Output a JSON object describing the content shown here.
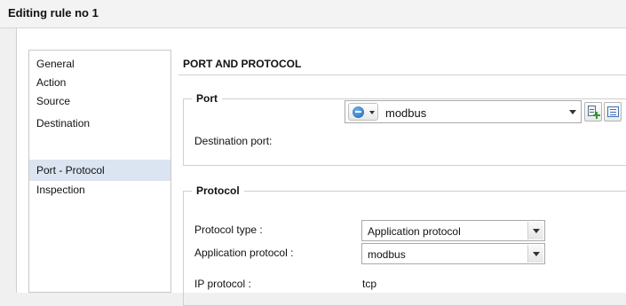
{
  "window": {
    "title": "Editing rule no 1"
  },
  "nav": {
    "items": [
      {
        "label": "General"
      },
      {
        "label": "Action"
      },
      {
        "label": "Source"
      },
      {
        "label": "Destination"
      },
      {
        "label": "Port - Protocol",
        "selected": true
      },
      {
        "label": "Inspection"
      }
    ]
  },
  "section": {
    "title": "PORT AND PROTOCOL"
  },
  "port_group": {
    "legend": "Port",
    "destination_port_label": "Destination port:",
    "destination_port_value": "modbus",
    "icons": {
      "type_selector": "object-globe-icon",
      "add": "add-object-icon",
      "list": "list-icon"
    }
  },
  "protocol_group": {
    "legend": "Protocol",
    "protocol_type_label": "Protocol type :",
    "protocol_type_value": "Application protocol",
    "application_protocol_label": "Application protocol :",
    "application_protocol_value": "modbus",
    "ip_protocol_label": "IP protocol :",
    "ip_protocol_value": "tcp"
  },
  "colors": {
    "selected_nav_bg": "#dbe5f1",
    "object_icon_blue": "#1a5fb0",
    "add_plus_green": "#2f9a2f"
  }
}
